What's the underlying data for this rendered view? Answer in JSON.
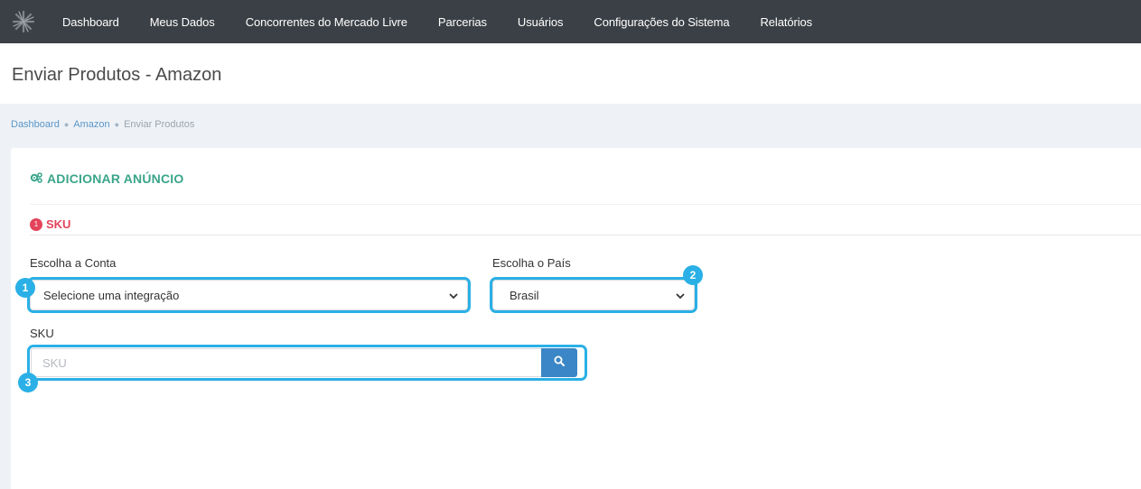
{
  "nav": {
    "logo_icon": "star-burst-logo-icon",
    "items": [
      "Dashboard",
      "Meus Dados",
      "Concorrentes do Mercado Livre",
      "Parcerias",
      "Usuários",
      "Configurações do Sistema",
      "Relatórios"
    ]
  },
  "page": {
    "title": "Enviar Produtos - Amazon"
  },
  "breadcrumb": {
    "items": [
      "Dashboard",
      "Amazon",
      "Enviar Produtos"
    ]
  },
  "card": {
    "title": "ADICIONAR ANÚNCIO",
    "title_icon": "cogs-icon",
    "section": {
      "number": "1",
      "label": "SKU"
    },
    "account": {
      "label": "Escolha a Conta",
      "value": "Selecione uma integração"
    },
    "country": {
      "label": "Escolha o País",
      "value": "Brasil"
    },
    "sku": {
      "label": "SKU",
      "placeholder": "SKU",
      "value": ""
    }
  },
  "callouts": [
    "1",
    "2",
    "3"
  ],
  "colors": {
    "nav_bg": "#3b4046",
    "accent_green": "#3aa58a",
    "accent_red": "#e3445b",
    "highlight_blue": "#2ab0e6",
    "button_blue": "#3b86c6"
  }
}
